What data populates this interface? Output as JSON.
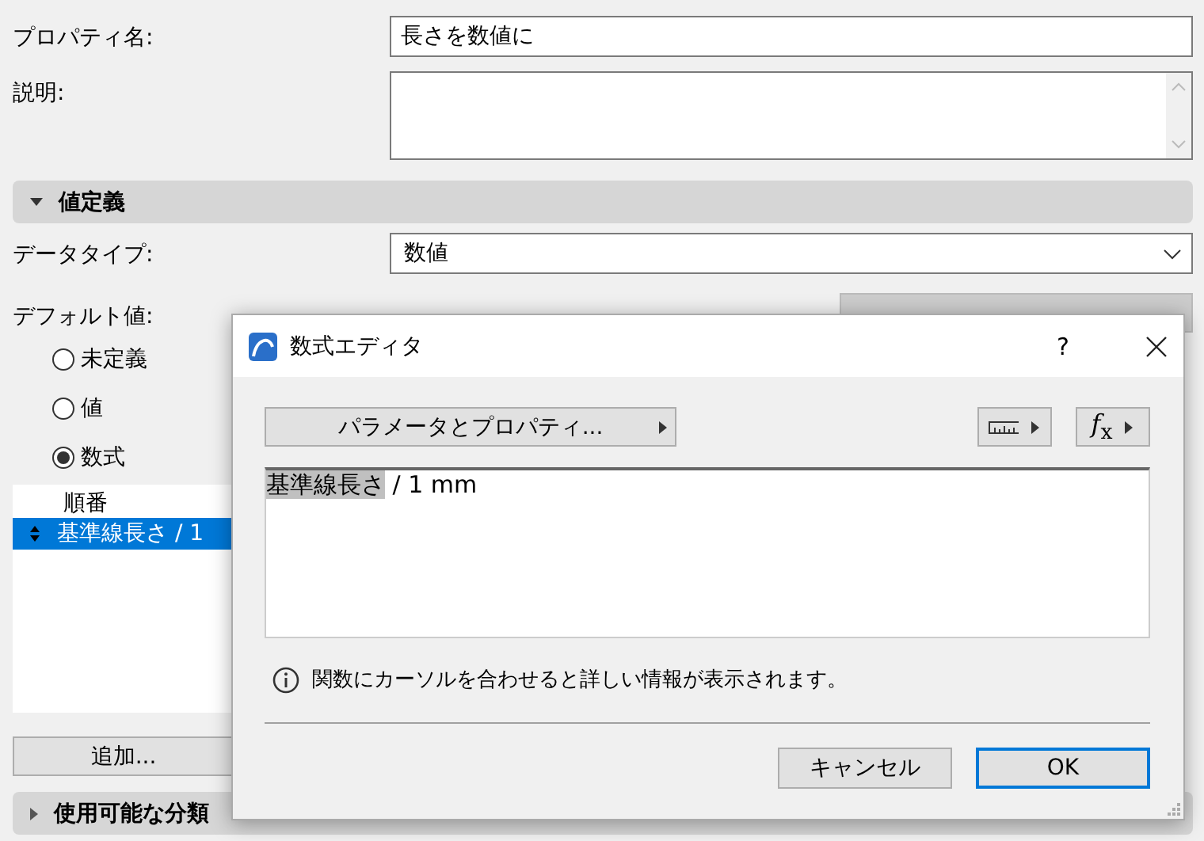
{
  "form": {
    "property_name": {
      "label": "プロパティ名:",
      "value": "長さを数値に"
    },
    "description": {
      "label": "説明:"
    },
    "value_section": {
      "title": "値定義",
      "expanded": true
    },
    "data_type": {
      "label": "データタイプ:",
      "value": "数値"
    },
    "default_value": {
      "label": "デフォルト値:"
    },
    "options": [
      {
        "label": "未定義",
        "selected": false
      },
      {
        "label": "値",
        "selected": false
      },
      {
        "label": "数式",
        "selected": true
      }
    ],
    "list": {
      "header": "順番",
      "rows": [
        {
          "text": "基準線長さ / 1",
          "selected": true
        }
      ]
    },
    "add_button": "追加...",
    "classification_section": {
      "title": "使用可能な分類",
      "expanded": false
    }
  },
  "dialog": {
    "title": "数式エディタ",
    "help": "?",
    "params_button": "パラメータとプロパティ...",
    "function_button": "*f*$_{x}$",
    "formula": {
      "highlighted": "基準線長さ",
      "rest": "/ 1 mm"
    },
    "info": "関数にカーソルを合わせると詳しい情報が表示されます。",
    "buttons": [
      {
        "label": "キャンセル",
        "default": false
      },
      {
        "label": "OK",
        "default": true
      }
    ]
  }
}
